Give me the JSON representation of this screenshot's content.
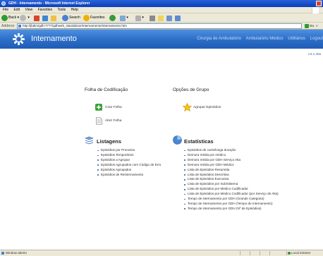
{
  "browser": {
    "window_title": "GDH - Internamento - Microsoft Internet Explorer",
    "menu": [
      "File",
      "Edit",
      "View",
      "Favorites",
      "Tools",
      "Help"
    ],
    "toolbar": {
      "back_label": "Back",
      "search_label": "Search",
      "favorites_label": "Favorites"
    },
    "address": {
      "label": "Address",
      "url": "http://jbdim/gdh:7777/gdhweb_standalone/Internamento/Internamento.htm",
      "go_label": "Go",
      "links_label": "»"
    },
    "status": {
      "text": "Window aberto",
      "zone": "Local intranet"
    }
  },
  "app": {
    "title": "Internamento",
    "nav": [
      "Cirurgia de Ambulatório",
      "Ambulatório Médico",
      "Utilitários",
      "Logout"
    ],
    "version": "v.6.1.40a"
  },
  "folha": {
    "title": "Folha de Codificação",
    "items": [
      "Criar Folha",
      "Abrir Folha"
    ]
  },
  "grupo": {
    "title": "Opções de Grupo",
    "items": [
      "Agrupar Episódios"
    ]
  },
  "listagens": {
    "title": "Listagens",
    "items": [
      "Episódios por Processo",
      "Episódios Temporários",
      "Episódios a Agrupar",
      "Episódios Agrupados com Código de Erro",
      "Episódios Agrupados",
      "Episódios de Reinternamento"
    ]
  },
  "estatisticas": {
    "title": "Estatísticas",
    "items": [
      "Episódios de curta/longa duração",
      "Demora média por médico",
      "Demora média por GDH Serviço Alta",
      "Demora média por GDH Médico",
      "Lista de Episódios Resumida",
      "Lista de Episódios Descritiva",
      "Lista de Episódios Executiva",
      "Lista de Episódios por SubSistema",
      "Lista de Episódios por Médico Codificador",
      "Lista de Episódios por Médico Codificador (por Serviço de Alta)",
      "Tempo de internamento por GDH (Grande Categoria)",
      "Tempo de internamento por GDH (Tempo de Internamento)",
      "Tempo de internamento por GDH (Nº de Episódios)"
    ]
  }
}
